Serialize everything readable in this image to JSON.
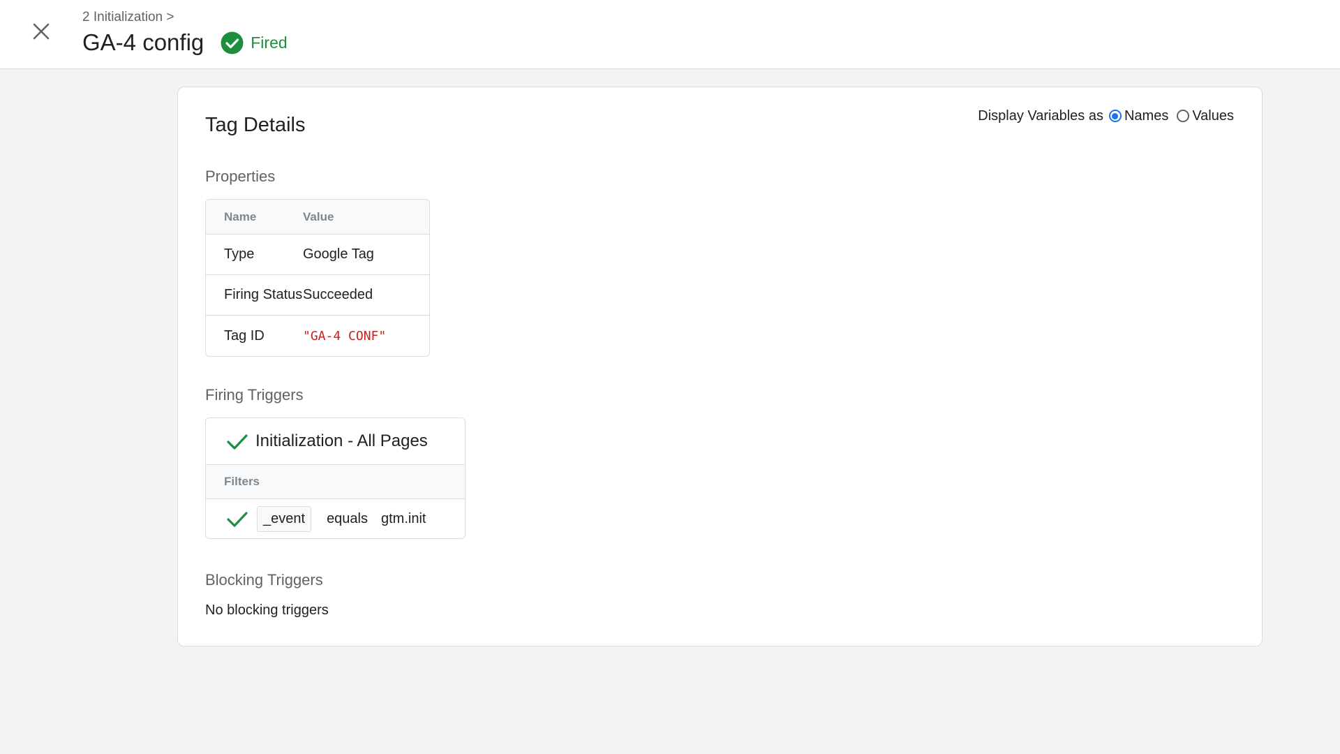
{
  "header": {
    "breadcrumb": "2 Initialization >",
    "title": "GA-4 config",
    "status": "Fired",
    "close_icon": "close-icon",
    "status_icon": "check-circle-icon",
    "status_color": "#1e8e3e"
  },
  "card": {
    "title": "Tag Details",
    "display_vars": {
      "label": "Display Variables as",
      "options": [
        {
          "label": "Names",
          "selected": true
        },
        {
          "label": "Values",
          "selected": false
        }
      ],
      "accent_color": "#1a73e8"
    },
    "properties": {
      "section_title": "Properties",
      "columns": [
        "Name",
        "Value"
      ],
      "rows": [
        {
          "name": "Type",
          "value": "Google Tag"
        },
        {
          "name": "Firing Status",
          "value": "Succeeded"
        },
        {
          "name": "Tag ID",
          "value": "\"GA-4 CONF\""
        }
      ]
    },
    "firing_triggers": {
      "section_title": "Firing Triggers",
      "trigger_name": "Initialization - All Pages",
      "filters_label": "Filters",
      "filter": {
        "variable": "_event",
        "operator": "equals",
        "value": "gtm.init"
      }
    },
    "blocking_triggers": {
      "section_title": "Blocking Triggers",
      "empty_text": "No blocking triggers"
    }
  }
}
